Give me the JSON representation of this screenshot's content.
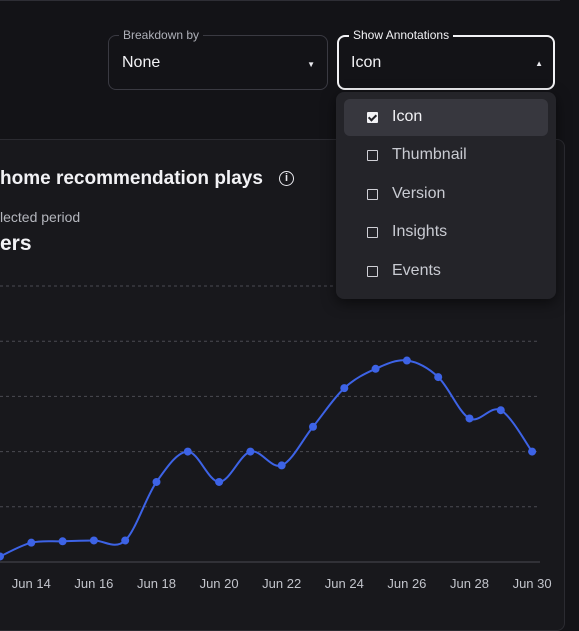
{
  "controls": {
    "breakdown": {
      "label": "Breakdown by",
      "value": "None"
    },
    "annotations": {
      "label": "Show Annotations",
      "value": "Icon",
      "options": [
        {
          "label": "Icon",
          "checked": true
        },
        {
          "label": "Thumbnail",
          "checked": false
        },
        {
          "label": "Version",
          "checked": false
        },
        {
          "label": "Insights",
          "checked": false
        },
        {
          "label": "Events",
          "checked": false
        }
      ]
    }
  },
  "panel": {
    "title": "home recommendation plays",
    "period_text": "lected period",
    "metric_text": "ers"
  },
  "colors": {
    "line": "#3d63e6",
    "grid": "#4a4a52",
    "background": "#131317"
  },
  "chart_data": {
    "type": "line",
    "xlabel": "",
    "ylabel": "",
    "grid": true,
    "x": [
      "Jun 13",
      "Jun 14",
      "Jun 15",
      "Jun 16",
      "Jun 17",
      "Jun 18",
      "Jun 19",
      "Jun 20",
      "Jun 21",
      "Jun 22",
      "Jun 23",
      "Jun 24",
      "Jun 25",
      "Jun 26",
      "Jun 27",
      "Jun 28",
      "Jun 29",
      "Jun 30"
    ],
    "tick_labels": [
      "Jun 14",
      "Jun 16",
      "Jun 18",
      "Jun 20",
      "Jun 22",
      "Jun 24",
      "Jun 26",
      "Jun 28",
      "Jun 30"
    ],
    "series": [
      {
        "values": [
          0.2,
          0.7,
          0.75,
          0.78,
          0.78,
          2.9,
          4.0,
          2.9,
          4.0,
          3.5,
          4.9,
          6.3,
          7.0,
          7.3,
          6.7,
          5.2,
          5.5,
          4.0
        ]
      }
    ],
    "ylim": [
      0,
      10
    ]
  }
}
